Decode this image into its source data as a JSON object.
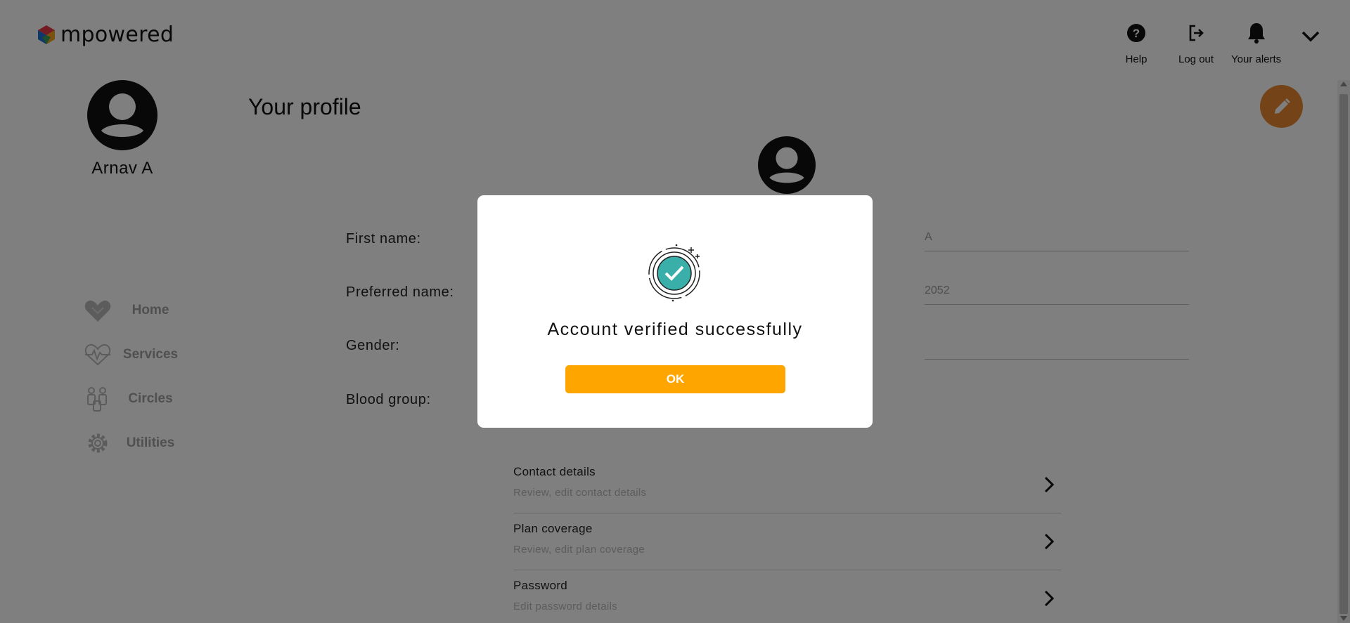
{
  "header": {
    "brand": "mpowered",
    "help_label": "Help",
    "logout_label": "Log out",
    "alerts_label": "Your alerts"
  },
  "sidebar": {
    "user_name": "Arnav A",
    "items": [
      {
        "label": "Home",
        "icon": "heart-hands-icon"
      },
      {
        "label": "Services",
        "icon": "heartbeat-icon"
      },
      {
        "label": "Circles",
        "icon": "people-icon"
      },
      {
        "label": "Utilities",
        "icon": "gear-icon"
      }
    ]
  },
  "main": {
    "title": "Your profile",
    "fields": [
      {
        "label": "First name:",
        "value": "A"
      },
      {
        "label": "Preferred name:",
        "value": "2052"
      },
      {
        "label": "Gender:",
        "value": ""
      },
      {
        "label": "Blood group:",
        "value": ""
      }
    ],
    "sections": [
      {
        "title": "Contact details",
        "subtitle": "Review, edit contact details"
      },
      {
        "title": "Plan coverage",
        "subtitle": "Review, edit plan coverage"
      },
      {
        "title": "Password",
        "subtitle": "Edit password details"
      }
    ]
  },
  "modal": {
    "message": "Account verified successfully",
    "ok_label": "OK"
  },
  "colors": {
    "accent_orange": "#ffa500",
    "edit_button": "#e8872f",
    "success_teal": "#3aafa9",
    "overlay": "rgba(0,0,0,0.5)"
  }
}
